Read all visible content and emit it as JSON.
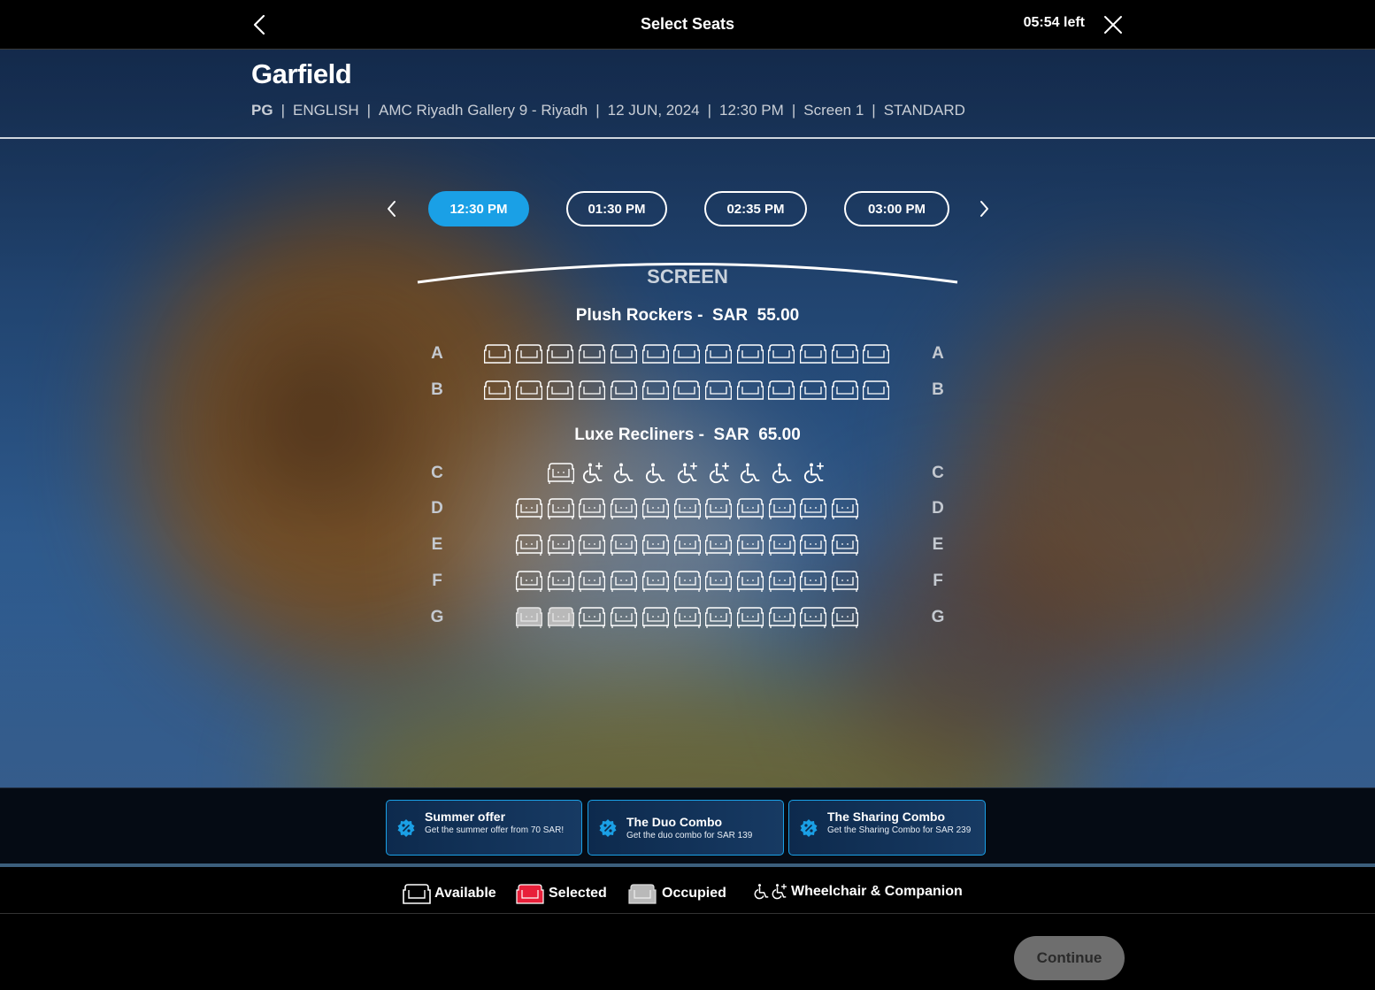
{
  "header": {
    "title": "Select Seats",
    "timer": "05:54 left"
  },
  "movie": {
    "title": "Garfield",
    "rating": "PG",
    "language": "ENGLISH",
    "cinema": "AMC Riyadh Gallery 9 - Riyadh",
    "date": "12 JUN, 2024",
    "time": "12:30 PM",
    "screen": "Screen 1",
    "format": "STANDARD"
  },
  "showtimes": [
    {
      "label": "12:30 PM",
      "selected": true
    },
    {
      "label": "01:30 PM",
      "selected": false
    },
    {
      "label": "02:35 PM",
      "selected": false
    },
    {
      "label": "03:00 PM",
      "selected": false
    }
  ],
  "screen_label": "SCREEN",
  "zones": [
    {
      "name": "Plush Rockers -",
      "currency": "SAR",
      "price": "55.00"
    },
    {
      "name": "Luxe Recliners -",
      "currency": "SAR",
      "price": "65.00"
    }
  ],
  "rows": [
    {
      "label": "A",
      "type": "rocker",
      "seats": [
        "available",
        "available",
        "available",
        "available",
        "available",
        "available",
        "available",
        "available",
        "available",
        "available",
        "available",
        "available",
        "available"
      ]
    },
    {
      "label": "B",
      "type": "rocker",
      "seats": [
        "available",
        "available",
        "available",
        "available",
        "available",
        "available",
        "available",
        "available",
        "available",
        "available",
        "available",
        "available",
        "available"
      ]
    },
    {
      "label": "C",
      "type": "recliner",
      "seats": [
        "available",
        "companion",
        "wheelchair",
        "wheelchair",
        "companion",
        "companion",
        "wheelchair",
        "wheelchair",
        "companion"
      ]
    },
    {
      "label": "D",
      "type": "recliner",
      "seats": [
        "available",
        "available",
        "available",
        "available",
        "available",
        "available",
        "available",
        "available",
        "available",
        "available",
        "available"
      ]
    },
    {
      "label": "E",
      "type": "recliner",
      "seats": [
        "available",
        "available",
        "available",
        "available",
        "available",
        "available",
        "available",
        "available",
        "available",
        "available",
        "available"
      ]
    },
    {
      "label": "F",
      "type": "recliner",
      "seats": [
        "available",
        "available",
        "available",
        "available",
        "available",
        "available",
        "available",
        "available",
        "available",
        "available",
        "available"
      ]
    },
    {
      "label": "G",
      "type": "recliner",
      "seats": [
        "occupied",
        "occupied",
        "available",
        "available",
        "available",
        "available",
        "available",
        "available",
        "available",
        "available",
        "available"
      ]
    }
  ],
  "offers": [
    {
      "title": "Summer offer",
      "description": "Get the summer offer from 70 SAR!"
    },
    {
      "title": "The Duo Combo",
      "description": "Get the duo combo for SAR 139"
    },
    {
      "title": "The Sharing Combo",
      "description": "Get the Sharing Combo for SAR 239"
    }
  ],
  "legend": {
    "available": "Available",
    "selected": "Selected",
    "occupied": "Occupied",
    "wheelchair": "Wheelchair & Companion"
  },
  "continue_label": "Continue",
  "colors": {
    "accent": "#1aa0e6",
    "selected_seat": "#e8203a",
    "occupied_seat": "#b9b9b9",
    "continue_bg": "#6e6e6e"
  }
}
